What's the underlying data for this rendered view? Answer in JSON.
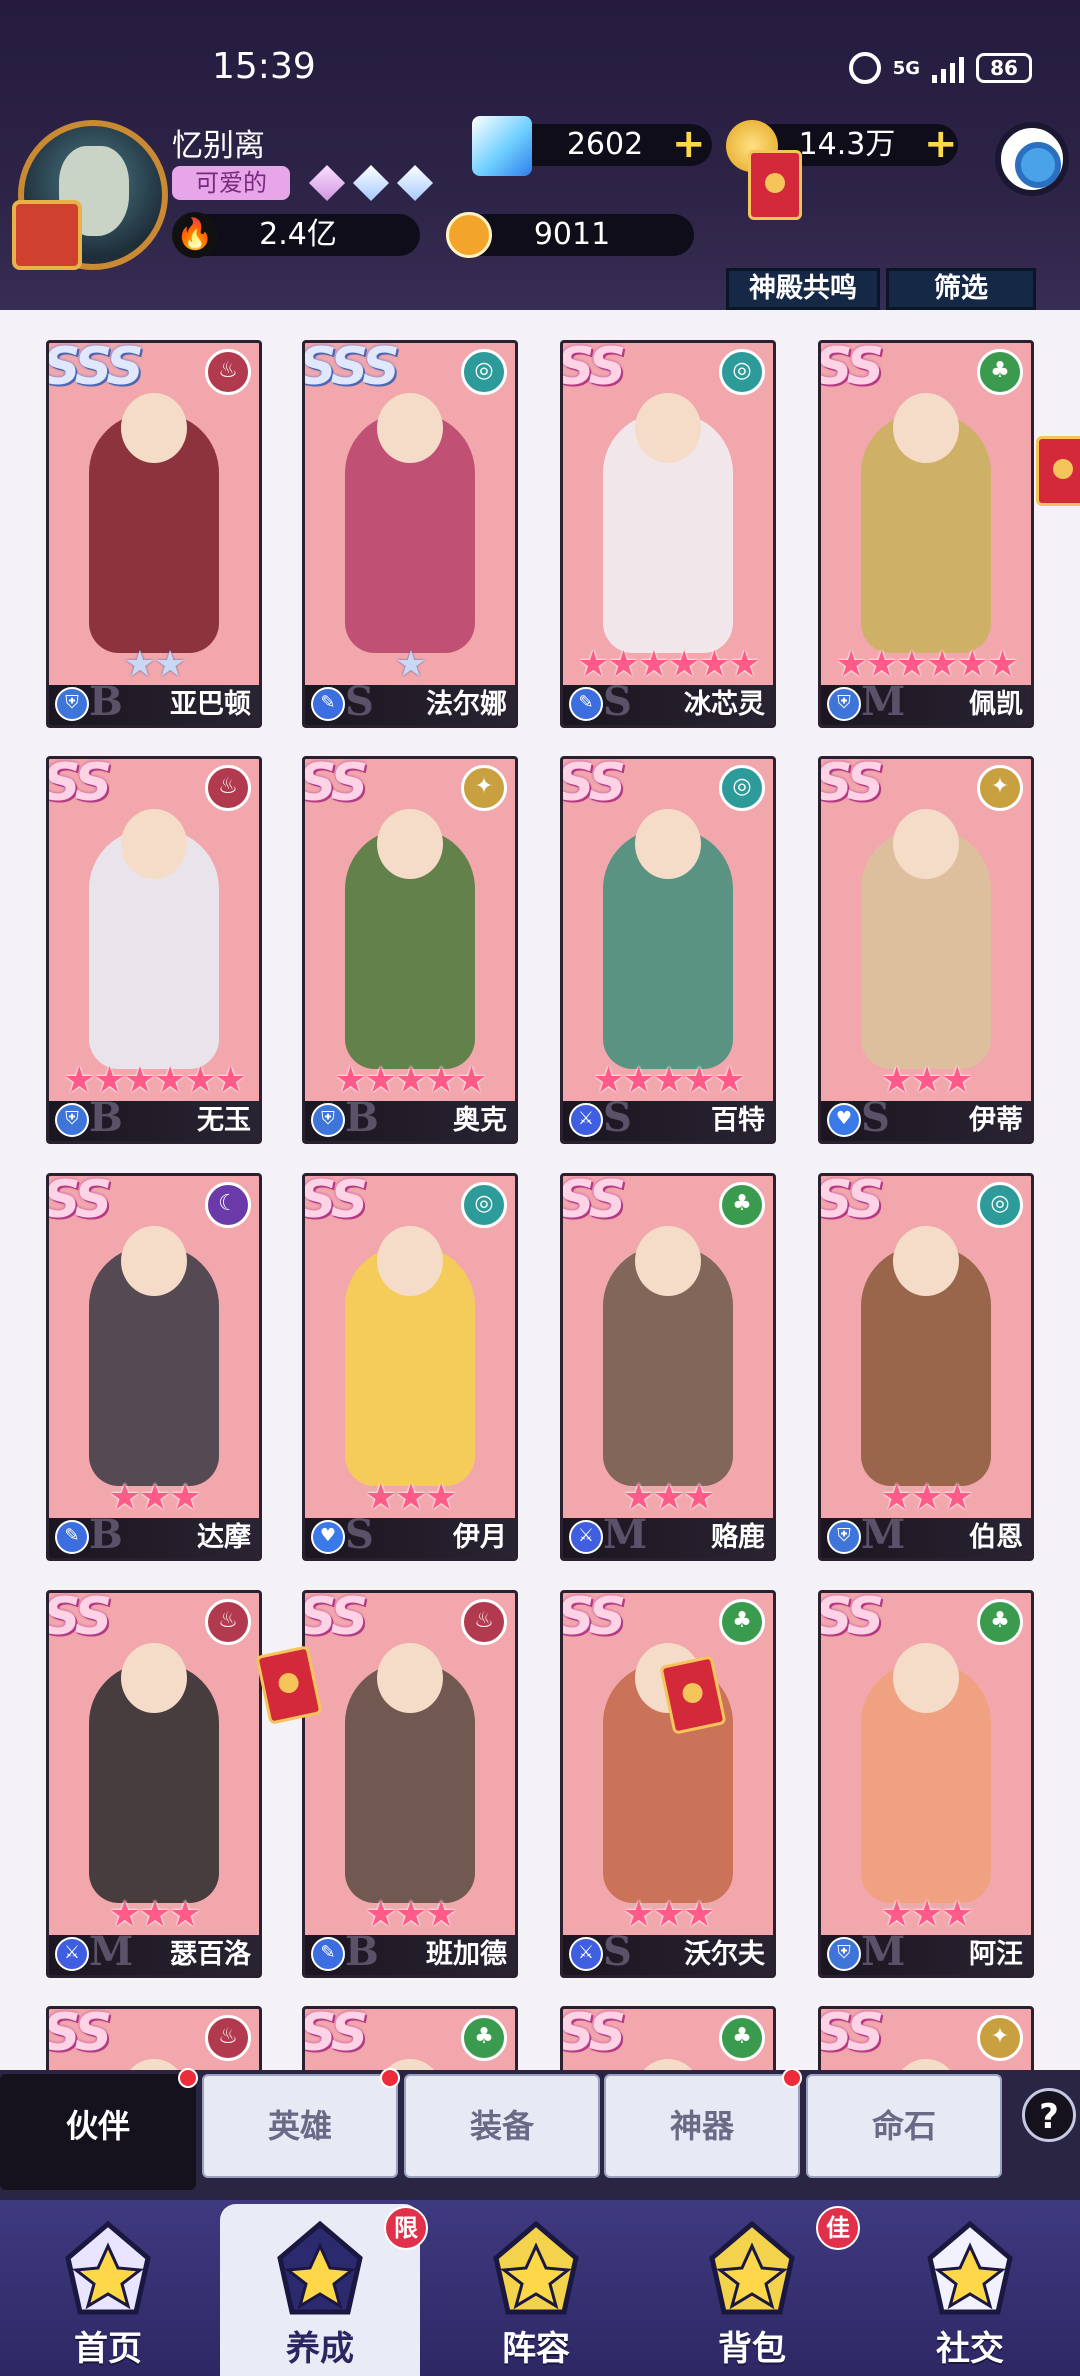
{
  "status_bar": {
    "time": "15:39",
    "network": "5G",
    "battery": "86"
  },
  "profile": {
    "name": "忆别离",
    "tag": "可爱的",
    "power": "2.4亿",
    "honor": "9011"
  },
  "resources": {
    "diamonds": "2602",
    "gold": "14.3万"
  },
  "top_buttons": {
    "resonance": "神殿共鸣",
    "filter": "筛选"
  },
  "colors": {
    "pink_card": "#f2a7ad",
    "header": "#241b3f",
    "nav": "#3f3a80",
    "red_dot": "#ee2b3a"
  },
  "cards": [
    {
      "name": "亚巴顿",
      "rank": "SSS",
      "element": "fire",
      "role": "shield",
      "grade": "B",
      "stars": 2,
      "star_style": "silver"
    },
    {
      "name": "法尔娜",
      "rank": "SSS",
      "element": "wind",
      "role": "magic",
      "grade": "S",
      "stars": 1,
      "star_style": "silver"
    },
    {
      "name": "冰芯灵",
      "rank": "SS",
      "element": "wind",
      "role": "magic",
      "grade": "S",
      "stars": 6,
      "star_style": "pink"
    },
    {
      "name": "佩凯",
      "rank": "SS",
      "element": "nature",
      "role": "shield",
      "grade": "M",
      "stars": 6,
      "star_style": "pink"
    },
    {
      "name": "无玉",
      "rank": "SS",
      "element": "fire",
      "role": "shield",
      "grade": "B",
      "stars": 6,
      "star_style": "pink"
    },
    {
      "name": "奥克",
      "rank": "SS",
      "element": "light",
      "role": "shield",
      "grade": "B",
      "stars": 5,
      "star_style": "pink"
    },
    {
      "name": "百特",
      "rank": "SS",
      "element": "wind",
      "role": "sword",
      "grade": "S",
      "stars": 5,
      "star_style": "pink"
    },
    {
      "name": "伊蒂",
      "rank": "SS",
      "element": "light",
      "role": "heal",
      "grade": "S",
      "stars": 3,
      "star_style": "pink"
    },
    {
      "name": "达摩",
      "rank": "SS",
      "element": "dark",
      "role": "magic",
      "grade": "B",
      "stars": 3,
      "star_style": "pink"
    },
    {
      "name": "伊月",
      "rank": "SS",
      "element": "wind",
      "role": "heal",
      "grade": "S",
      "stars": 3,
      "star_style": "pink"
    },
    {
      "name": "赂鹿",
      "rank": "SS",
      "element": "nature",
      "role": "sword",
      "grade": "M",
      "stars": 3,
      "star_style": "pink"
    },
    {
      "name": "伯恩",
      "rank": "SS",
      "element": "wind",
      "role": "shield",
      "grade": "M",
      "stars": 3,
      "star_style": "pink"
    },
    {
      "name": "瑟百洛",
      "rank": "SS",
      "element": "fire",
      "role": "sword",
      "grade": "M",
      "stars": 3,
      "star_style": "pink"
    },
    {
      "name": "班加德",
      "rank": "SS",
      "element": "fire",
      "role": "magic",
      "grade": "B",
      "stars": 3,
      "star_style": "pink"
    },
    {
      "name": "沃尔夫",
      "rank": "SS",
      "element": "nature",
      "role": "sword",
      "grade": "S",
      "stars": 3,
      "star_style": "pink"
    },
    {
      "name": "阿汪",
      "rank": "SS",
      "element": "nature",
      "role": "shield",
      "grade": "M",
      "stars": 3,
      "star_style": "pink"
    },
    {
      "name": "",
      "rank": "SS",
      "element": "fire",
      "role": "",
      "grade": "",
      "stars": 0,
      "star_style": "pink"
    },
    {
      "name": "",
      "rank": "SS",
      "element": "nature",
      "role": "",
      "grade": "",
      "stars": 0,
      "star_style": "pink"
    },
    {
      "name": "",
      "rank": "SS",
      "element": "nature",
      "role": "",
      "grade": "",
      "stars": 0,
      "star_style": "pink"
    },
    {
      "name": "",
      "rank": "SS",
      "element": "light",
      "role": "",
      "grade": "",
      "stars": 0,
      "star_style": "pink"
    }
  ],
  "sub_tabs": [
    {
      "label": "伙伴",
      "active": true,
      "dot": true
    },
    {
      "label": "英雄",
      "active": false,
      "dot": true
    },
    {
      "label": "装备",
      "active": false,
      "dot": false
    },
    {
      "label": "神器",
      "active": false,
      "dot": true
    },
    {
      "label": "命石",
      "active": false,
      "dot": false
    }
  ],
  "help_label": "?",
  "nav": [
    {
      "label": "首页",
      "icon": "home-castle-icon",
      "active": false,
      "badge": ""
    },
    {
      "label": "养成",
      "icon": "star-training-icon",
      "active": true,
      "badge": "限"
    },
    {
      "label": "阵容",
      "icon": "lineup-shield-icon",
      "active": false,
      "badge": ""
    },
    {
      "label": "背包",
      "icon": "backpack-icon",
      "active": false,
      "badge": "佳"
    },
    {
      "label": "社交",
      "icon": "social-ghost-icon",
      "active": false,
      "badge": ""
    }
  ]
}
